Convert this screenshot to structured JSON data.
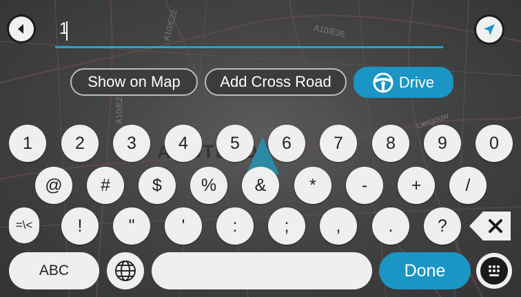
{
  "search": {
    "value": "1"
  },
  "actions": {
    "show_on_map": "Show on Map",
    "add_cross_road": "Add Cross Road",
    "drive": "Drive"
  },
  "map": {
    "road_labels": [
      "A10/E22",
      "A10/E35",
      "A10/E22",
      "Liergouw"
    ],
    "city": "AMSTERDAM"
  },
  "keyboard": {
    "number_row": [
      "1",
      "2",
      "3",
      "4",
      "5",
      "6",
      "7",
      "8",
      "9",
      "0"
    ],
    "symbol_row": [
      "@",
      "#",
      "$",
      "%",
      "&",
      "*",
      "-",
      "+",
      "/"
    ],
    "punct_row": [
      "!",
      "\"",
      "'",
      ":",
      ";",
      ",",
      ".",
      "?"
    ],
    "symbols_toggle": "=\\<",
    "abc": "ABC",
    "done": "Done"
  },
  "colors": {
    "accent": "#1a95c4",
    "key": "#efefef",
    "line": "#1fa6d2"
  }
}
